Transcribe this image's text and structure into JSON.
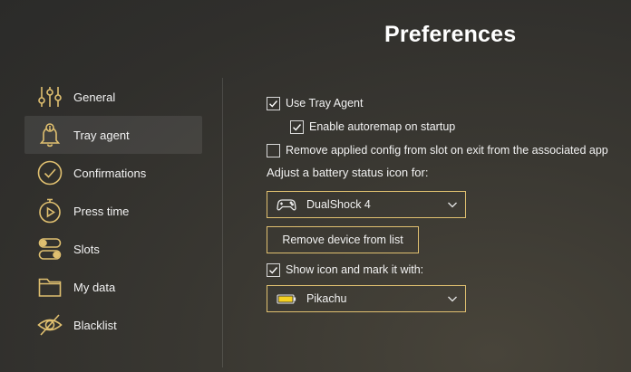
{
  "page": {
    "title": "Preferences"
  },
  "colors": {
    "accent": "#e0c070",
    "active_bg": "#3c3b38"
  },
  "sidebar": {
    "items": [
      {
        "label": "General",
        "icon": "sliders-icon",
        "active": false
      },
      {
        "label": "Tray agent",
        "icon": "bell-alert-icon",
        "active": true
      },
      {
        "label": "Confirmations",
        "icon": "check-circle-icon",
        "active": false
      },
      {
        "label": "Press time",
        "icon": "stopwatch-play-icon",
        "active": false
      },
      {
        "label": "Slots",
        "icon": "toggles-icon",
        "active": false
      },
      {
        "label": "My data",
        "icon": "folder-icon",
        "active": false
      },
      {
        "label": "Blacklist",
        "icon": "eye-slash-icon",
        "active": false
      }
    ]
  },
  "tray": {
    "use_tray_agent": {
      "label": "Use Tray Agent",
      "checked": true
    },
    "enable_autoremap": {
      "label": "Enable autoremap on startup",
      "checked": true
    },
    "remove_config": {
      "label": "Remove applied config from slot on exit from the associated app",
      "checked": false
    },
    "battery_label": "Adjust a battery status icon for:",
    "device_dropdown": {
      "value": "DualShock 4",
      "icon": "gamepad-icon"
    },
    "remove_device_button": "Remove device from list",
    "show_icon": {
      "label": "Show icon and mark it with:",
      "checked": true
    },
    "mark_dropdown": {
      "value": "Pikachu",
      "icon": "battery-icon"
    }
  }
}
